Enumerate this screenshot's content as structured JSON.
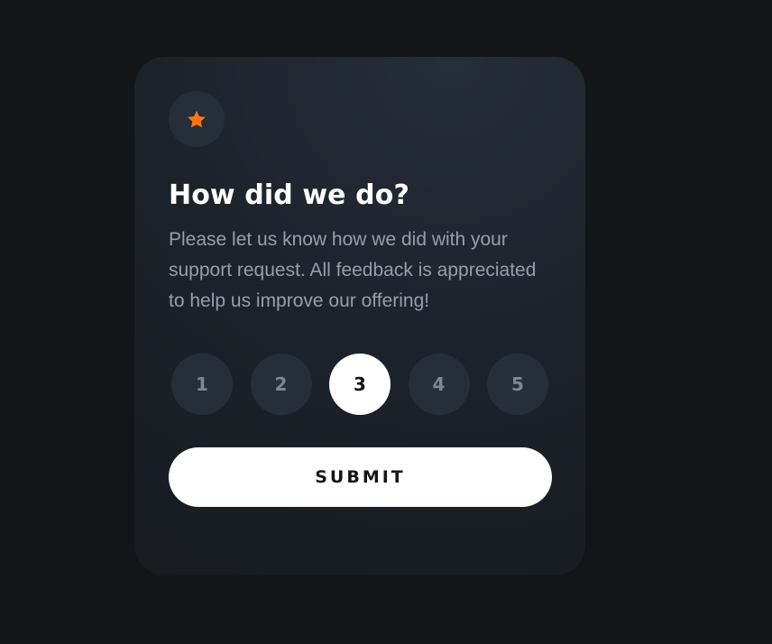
{
  "card": {
    "title": "How did we do?",
    "description": "Please let us know how we did with your support request. All feedback is appreciated to help us improve our offering!",
    "icon": "star-icon",
    "accent_color": "#fc7614"
  },
  "ratings": {
    "options": [
      "1",
      "2",
      "3",
      "4",
      "5"
    ],
    "selected": "3"
  },
  "submit": {
    "label": "SUBMIT"
  }
}
